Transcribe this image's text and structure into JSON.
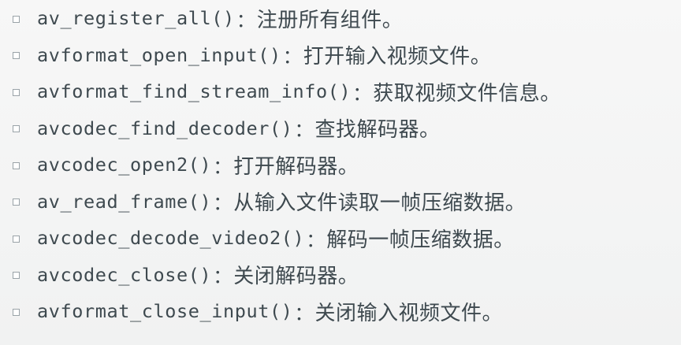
{
  "colors": {
    "background": "#f3f4f4",
    "text": "#3e494f",
    "bullet_border": "#9aa3a8"
  },
  "bullet_icon": "hollow-square-bullet",
  "items": [
    {
      "fn": "av_register_all()",
      "sep": "：",
      "desc": "注册所有组件。"
    },
    {
      "fn": "avformat_open_input()",
      "sep": "：",
      "desc": "打开输入视频文件。"
    },
    {
      "fn": "avformat_find_stream_info()",
      "sep": "：",
      "desc": "获取视频文件信息。"
    },
    {
      "fn": "avcodec_find_decoder()",
      "sep": "：",
      "desc": "查找解码器。"
    },
    {
      "fn": "avcodec_open2()",
      "sep": "：",
      "desc": "打开解码器。"
    },
    {
      "fn": "av_read_frame()",
      "sep": "：",
      "desc": "从输入文件读取一帧压缩数据。"
    },
    {
      "fn": "avcodec_decode_video2()",
      "sep": "：",
      "desc": "解码一帧压缩数据。"
    },
    {
      "fn": "avcodec_close()",
      "sep": "：",
      "desc": "关闭解码器。"
    },
    {
      "fn": "avformat_close_input()",
      "sep": "：",
      "desc": "关闭输入视频文件。"
    }
  ]
}
